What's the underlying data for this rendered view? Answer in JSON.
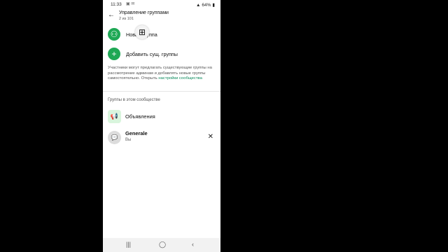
{
  "status_bar": {
    "time": "11:33",
    "battery": "64%"
  },
  "header": {
    "title": "Управление группами",
    "subtitle": "2 из 101"
  },
  "actions": {
    "new_group": "Новая группа",
    "add_existing": "Добавить сущ. группы"
  },
  "info": {
    "text": "Участники могут предлагать существующие группы на рассмотрение админам и добавлять новые группы самостоятельно. Открыть",
    "link": "настройки сообщества"
  },
  "section": {
    "title": "Группы в этом сообществе"
  },
  "groups": [
    {
      "name": "Объявления"
    },
    {
      "name": "Generale",
      "subtitle": "Вы"
    }
  ],
  "icons": {
    "back": "arrow-left",
    "new_group": "group-add",
    "add_existing": "plus",
    "announcements": "megaphone",
    "general": "chat-bubble",
    "remove": "close-x",
    "overlay": "app-grid"
  },
  "colors": {
    "accent": "#1fa855",
    "link": "#0d8a5c"
  }
}
